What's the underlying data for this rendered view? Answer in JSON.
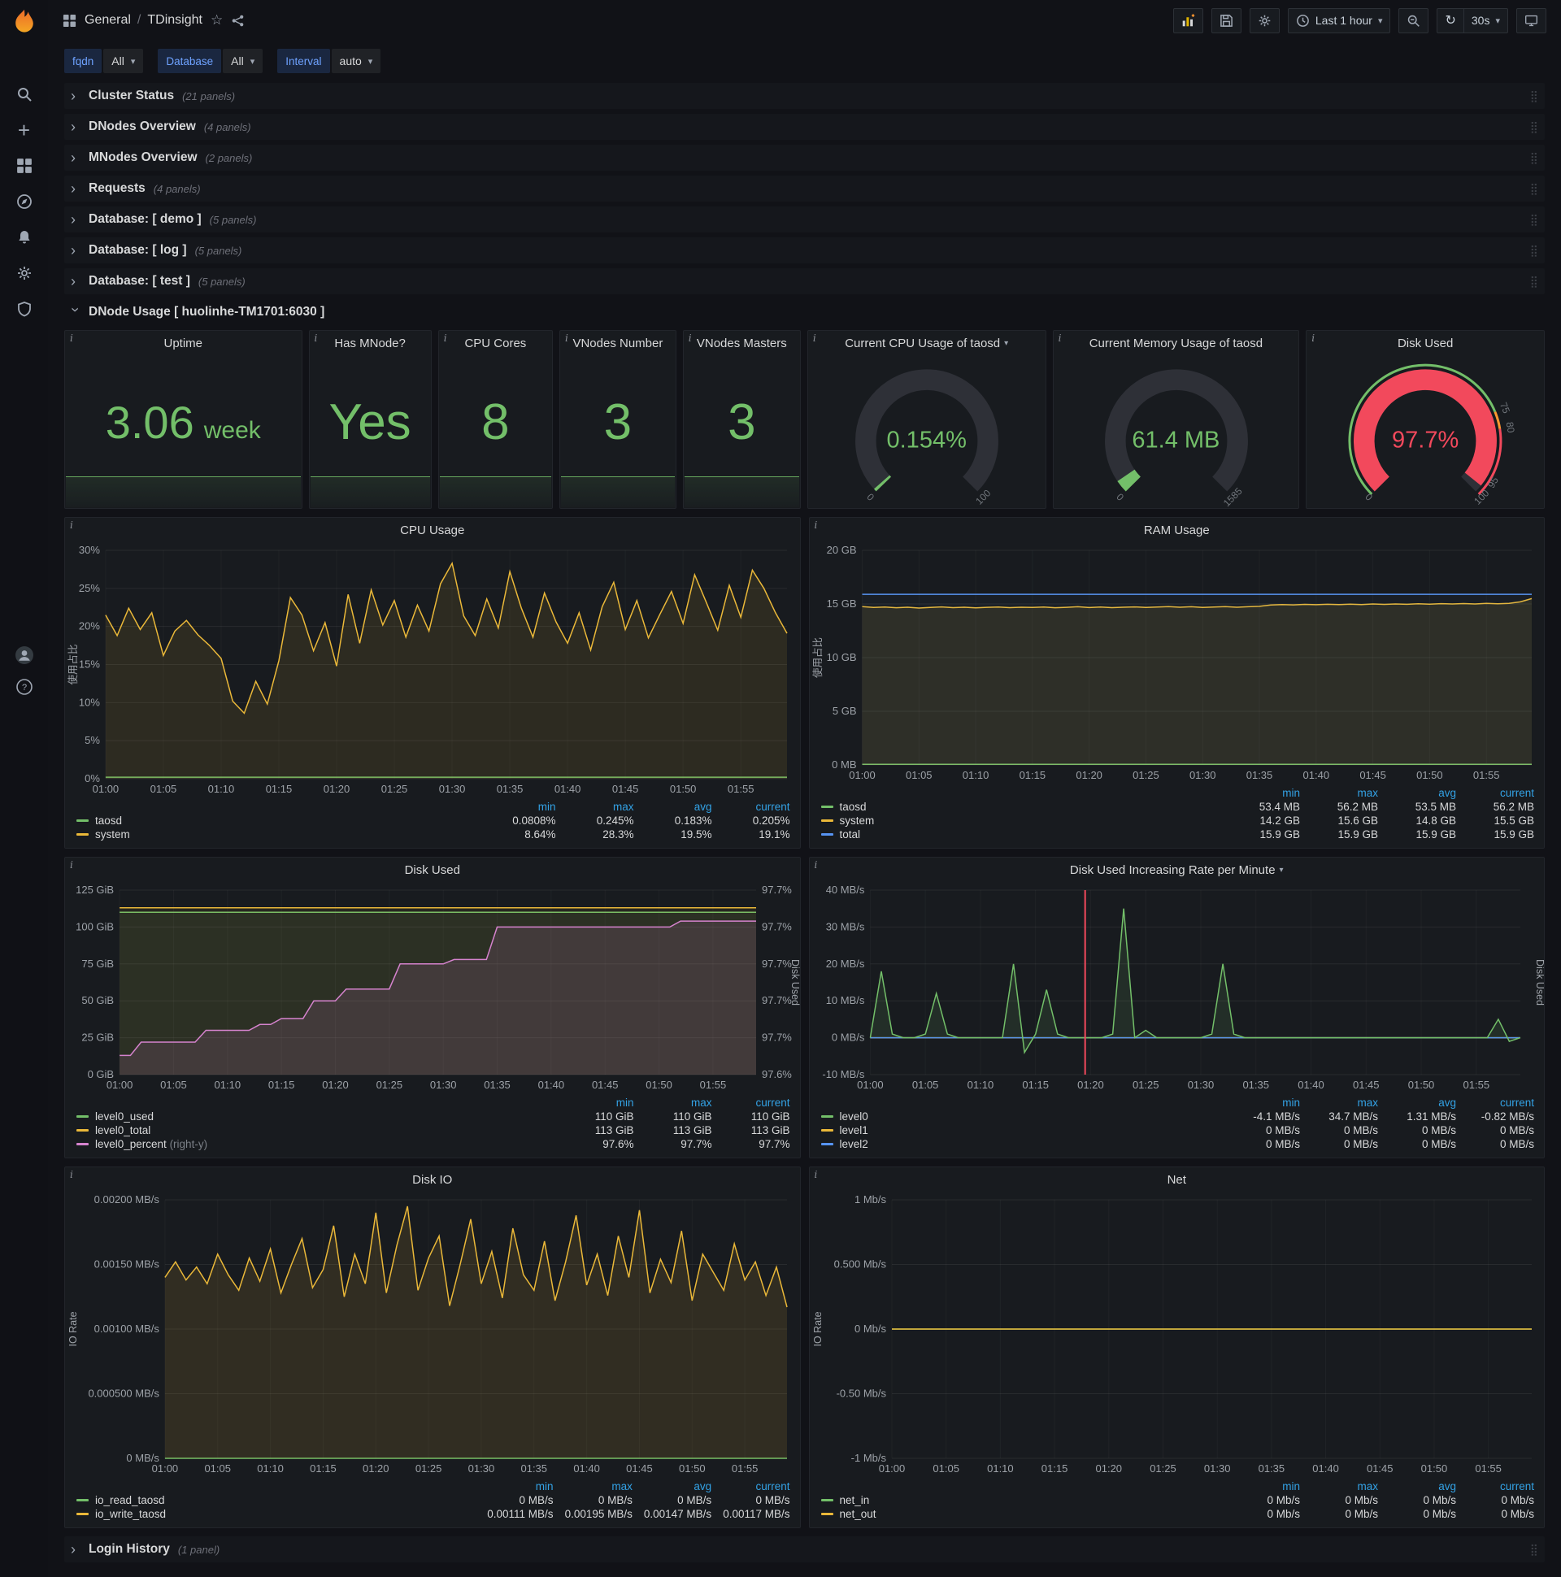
{
  "colors": {
    "green": "#73bf69",
    "yellow": "#eab839",
    "blue": "#5794f2",
    "pink": "#d683ce",
    "red": "#f2495c",
    "orange": "#ff9830",
    "legend_header": "#33a2e5",
    "stat_value": "#73bf69"
  },
  "navbar": {
    "breadcrumb_section": "General",
    "breadcrumb_sep": "/",
    "breadcrumb_title": "TDinsight",
    "time_range": "Last 1 hour",
    "refresh_interval": "30s"
  },
  "sidebar": {
    "icons": [
      "search",
      "create",
      "dashboards",
      "explore",
      "alerting",
      "configuration",
      "server-admin"
    ],
    "bottom": [
      "user-avatar",
      "help"
    ]
  },
  "variables": [
    {
      "label": "fqdn",
      "value": "All"
    },
    {
      "label": "Database",
      "value": "All"
    },
    {
      "label": "Interval",
      "value": "auto"
    }
  ],
  "rows": [
    {
      "title": "Cluster Status",
      "count": "(21 panels)"
    },
    {
      "title": "DNodes Overview",
      "count": "(4 panels)"
    },
    {
      "title": "MNodes Overview",
      "count": "(2 panels)"
    },
    {
      "title": "Requests",
      "count": "(4 panels)"
    },
    {
      "title": "Database: [ demo ]",
      "count": "(5 panels)"
    },
    {
      "title": "Database: [ log ]",
      "count": "(5 panels)"
    },
    {
      "title": "Database: [ test ]",
      "count": "(5 panels)"
    }
  ],
  "expanded_row": {
    "title": "DNode Usage [ huolinhe-TM1701:6030 ]"
  },
  "bottom_row": {
    "title": "Login History",
    "count": "(1 panel)"
  },
  "stats": [
    {
      "title": "Uptime",
      "value": "3.06",
      "unit": "week"
    },
    {
      "title": "Has MNode?",
      "value": "Yes"
    },
    {
      "title": "CPU Cores",
      "value": "8"
    },
    {
      "title": "VNodes Number",
      "value": "3"
    },
    {
      "title": "VNodes Masters",
      "value": "3"
    }
  ],
  "gauges": [
    {
      "title": "Current CPU Usage of taosd",
      "has_menu": true,
      "value": "0.154%",
      "value_color": "#73bf69",
      "arc_color": "#73bf69",
      "percent": 0.154,
      "min_label": "0",
      "max_label": "100"
    },
    {
      "title": "Current Memory Usage of taosd",
      "value": "61.4 MB",
      "value_color": "#73bf69",
      "arc_color": "#73bf69",
      "percent": 3.9,
      "min_label": "0",
      "max_label": "1585"
    },
    {
      "title": "Disk Used",
      "value": "97.7%",
      "value_color": "#f2495c",
      "arc_color": "#f2495c",
      "percent": 97.7,
      "min_label": "0",
      "max_label": "100",
      "threshold_segments": [
        {
          "to": 75,
          "color": "#73bf69"
        },
        {
          "to": 80,
          "color": "#ff9830"
        },
        {
          "to": 100,
          "color": "#f2495c"
        }
      ],
      "threshold_labels": [
        {
          "pct": 75,
          "label": "75"
        },
        {
          "pct": 80,
          "label": "80"
        },
        {
          "pct": 95,
          "label": "95"
        }
      ]
    }
  ],
  "charts": [
    {
      "type": "line",
      "title": "CPU Usage",
      "ylabel": "使用占比",
      "ylim": [
        0,
        30
      ],
      "yticks": [
        {
          "v": 30,
          "label": "30%"
        },
        {
          "v": 25,
          "label": "25%"
        },
        {
          "v": 20,
          "label": "20%"
        },
        {
          "v": 15,
          "label": "15%"
        },
        {
          "v": 10,
          "label": "10%"
        },
        {
          "v": 5,
          "label": "5%"
        },
        {
          "v": 0,
          "label": "0%"
        }
      ],
      "xticks": [
        "01:00",
        "01:05",
        "01:10",
        "01:15",
        "01:20",
        "01:25",
        "01:30",
        "01:35",
        "01:40",
        "01:45",
        "01:50",
        "01:55"
      ],
      "series": [
        {
          "name": "taosd",
          "color": "#73bf69",
          "fill": 0.06,
          "flat": 0.2
        },
        {
          "name": "system",
          "color": "#eab839",
          "fill": 0.1,
          "values": [
            21.5,
            18.8,
            22.4,
            19.6,
            21.8,
            16.2,
            19.4,
            20.8,
            18.9,
            17.5,
            15.8,
            10.2,
            8.6,
            12.8,
            9.8,
            15.5,
            23.8,
            21.5,
            16.8,
            20.5,
            14.8,
            24.2,
            17.8,
            24.8,
            20.2,
            23.4,
            18.6,
            22.8,
            19.4,
            25.6,
            28.3,
            21.4,
            18.8,
            23.6,
            19.8,
            27.2,
            22.4,
            18.6,
            24.4,
            20.6,
            17.8,
            21.8,
            16.9,
            22.6,
            25.8,
            19.6,
            23.4,
            18.5,
            21.6,
            24.6,
            20.4,
            26.8,
            23.2,
            19.5,
            25.4,
            21.2,
            27.4,
            25.0,
            21.8,
            19.1
          ]
        }
      ],
      "legend": {
        "columns": [
          "min",
          "max",
          "avg",
          "current"
        ],
        "rows": [
          {
            "name": "taosd",
            "color": "#73bf69",
            "values": [
              "0.0808%",
              "0.245%",
              "0.183%",
              "0.205%"
            ]
          },
          {
            "name": "system",
            "color": "#eab839",
            "values": [
              "8.64%",
              "28.3%",
              "19.5%",
              "19.1%"
            ]
          }
        ]
      }
    },
    {
      "type": "line",
      "title": "RAM Usage",
      "ylabel": "使用占比",
      "ylim": [
        0,
        20
      ],
      "yticks": [
        {
          "v": 20,
          "label": "20 GB"
        },
        {
          "v": 15,
          "label": "15 GB"
        },
        {
          "v": 10,
          "label": "10 GB"
        },
        {
          "v": 5,
          "label": "5 GB"
        },
        {
          "v": 0,
          "label": "0 MB"
        }
      ],
      "xticks": [
        "01:00",
        "01:05",
        "01:10",
        "01:15",
        "01:20",
        "01:25",
        "01:30",
        "01:35",
        "01:40",
        "01:45",
        "01:50",
        "01:55"
      ],
      "series": [
        {
          "name": "taosd",
          "color": "#73bf69",
          "fill": 0.05,
          "flat": 0.055
        },
        {
          "name": "system",
          "color": "#eab839",
          "fill": 0.1,
          "values": [
            14.75,
            14.68,
            14.72,
            14.65,
            14.7,
            14.62,
            14.68,
            14.73,
            14.66,
            14.7,
            14.64,
            14.69,
            14.72,
            14.66,
            14.7,
            14.68,
            14.72,
            14.65,
            14.69,
            14.74,
            14.67,
            14.71,
            14.66,
            14.7,
            14.73,
            14.68,
            14.72,
            14.75,
            14.7,
            14.74,
            14.68,
            14.72,
            14.76,
            14.7,
            14.74,
            14.78,
            14.9,
            14.95,
            14.92,
            14.96,
            14.93,
            14.97,
            14.94,
            14.98,
            14.95,
            15.0,
            14.96,
            15.0,
            14.97,
            15.02,
            14.98,
            15.03,
            15.0,
            15.04,
            15.0,
            15.05,
            15.02,
            15.06,
            15.2,
            15.5
          ]
        },
        {
          "name": "total",
          "color": "#5794f2",
          "fill": 0.04,
          "flat": 15.9
        }
      ],
      "legend": {
        "columns": [
          "min",
          "max",
          "avg",
          "current"
        ],
        "rows": [
          {
            "name": "taosd",
            "color": "#73bf69",
            "values": [
              "53.4 MB",
              "56.2 MB",
              "53.5 MB",
              "56.2 MB"
            ]
          },
          {
            "name": "system",
            "color": "#eab839",
            "values": [
              "14.2 GB",
              "15.6 GB",
              "14.8 GB",
              "15.5 GB"
            ]
          },
          {
            "name": "total",
            "color": "#5794f2",
            "values": [
              "15.9 GB",
              "15.9 GB",
              "15.9 GB",
              "15.9 GB"
            ]
          }
        ]
      }
    },
    {
      "type": "line",
      "title": "Disk Used",
      "ylim": [
        0,
        125
      ],
      "yticks": [
        {
          "v": 125,
          "label": "125 GiB"
        },
        {
          "v": 100,
          "label": "100 GiB"
        },
        {
          "v": 75,
          "label": "75 GiB"
        },
        {
          "v": 50,
          "label": "50 GiB"
        },
        {
          "v": 25,
          "label": "25 GiB"
        },
        {
          "v": 0,
          "label": "0 GiB"
        }
      ],
      "right_ticks": [
        "97.7%",
        "97.7%",
        "97.7%",
        "97.7%",
        "97.7%",
        "97.6%"
      ],
      "right_ylabel": "Disk Used",
      "xticks": [
        "01:00",
        "01:05",
        "01:10",
        "01:15",
        "01:20",
        "01:25",
        "01:30",
        "01:35",
        "01:40",
        "01:45",
        "01:50",
        "01:55"
      ],
      "series": [
        {
          "name": "level0_used",
          "color": "#73bf69",
          "fill": 0.07,
          "flat": 110
        },
        {
          "name": "level0_total",
          "color": "#eab839",
          "fill": 0.07,
          "flat": 113
        },
        {
          "name": "level0_percent",
          "color": "#d683ce",
          "fill": 0.13,
          "values": [
            13,
            13,
            22,
            22,
            22,
            22,
            22,
            22,
            30,
            30,
            30,
            30,
            30,
            34,
            34,
            38,
            38,
            38,
            50,
            50,
            50,
            58,
            58,
            58,
            58,
            58,
            75,
            75,
            75,
            75,
            75,
            78,
            78,
            78,
            78,
            100,
            100,
            100,
            100,
            100,
            100,
            100,
            100,
            100,
            100,
            100,
            100,
            100,
            100,
            100,
            100,
            100,
            104,
            104,
            104,
            104,
            104,
            104,
            104,
            104
          ]
        }
      ],
      "legend": {
        "columns": [
          "min",
          "max",
          "current"
        ],
        "rows": [
          {
            "name": "level0_used",
            "color": "#73bf69",
            "values": [
              "110 GiB",
              "110 GiB",
              "110 GiB"
            ]
          },
          {
            "name": "level0_total",
            "color": "#eab839",
            "values": [
              "113 GiB",
              "113 GiB",
              "113 GiB"
            ]
          },
          {
            "name": "level0_percent",
            "color": "#d683ce",
            "suffix": "(right-y)",
            "values": [
              "97.6%",
              "97.7%",
              "97.7%"
            ]
          }
        ]
      }
    },
    {
      "type": "line",
      "title": "Disk Used Increasing Rate per Minute",
      "has_menu": true,
      "ylim": [
        -10,
        40
      ],
      "yticks": [
        {
          "v": 40,
          "label": "40 MB/s"
        },
        {
          "v": 30,
          "label": "30 MB/s"
        },
        {
          "v": 20,
          "label": "20 MB/s"
        },
        {
          "v": 10,
          "label": "10 MB/s"
        },
        {
          "v": 0,
          "label": "0 MB/s"
        },
        {
          "v": -10,
          "label": "-10 MB/s"
        }
      ],
      "right_ylabel": "Disk Used",
      "annotation_x": 19.5,
      "xticks": [
        "01:00",
        "01:05",
        "01:10",
        "01:15",
        "01:20",
        "01:25",
        "01:30",
        "01:35",
        "01:40",
        "01:45",
        "01:50",
        "01:55"
      ],
      "series": [
        {
          "name": "level1",
          "color": "#eab839",
          "flat": 0
        },
        {
          "name": "level2",
          "color": "#5794f2",
          "flat": 0
        },
        {
          "name": "level0",
          "color": "#73bf69",
          "fill": 0.12,
          "values": [
            0,
            18,
            1,
            0,
            0,
            1,
            12,
            1,
            0,
            0,
            0,
            0,
            0,
            20,
            -4,
            1,
            13,
            1,
            0,
            0,
            0,
            0,
            1,
            35,
            0,
            2,
            0,
            0,
            0,
            0,
            0,
            1,
            20,
            1,
            0,
            0,
            0,
            0,
            0,
            0,
            0,
            0,
            0,
            0,
            0,
            0,
            0,
            0,
            0,
            0,
            0,
            0,
            0,
            0,
            0,
            0,
            0,
            5,
            -1,
            0
          ]
        }
      ],
      "legend": {
        "columns": [
          "min",
          "max",
          "avg",
          "current"
        ],
        "rows": [
          {
            "name": "level0",
            "color": "#73bf69",
            "values": [
              "-4.1 MB/s",
              "34.7 MB/s",
              "1.31 MB/s",
              "-0.82 MB/s"
            ]
          },
          {
            "name": "level1",
            "color": "#eab839",
            "values": [
              "0 MB/s",
              "0 MB/s",
              "0 MB/s",
              "0 MB/s"
            ]
          },
          {
            "name": "level2",
            "color": "#5794f2",
            "values": [
              "0 MB/s",
              "0 MB/s",
              "0 MB/s",
              "0 MB/s"
            ]
          }
        ]
      }
    },
    {
      "type": "line",
      "title": "Disk IO",
      "ylabel": "IO Rate",
      "ylim": [
        0,
        0.002
      ],
      "yticks": [
        {
          "v": 0.002,
          "label": "0.00200 MB/s"
        },
        {
          "v": 0.0015,
          "label": "0.00150 MB/s"
        },
        {
          "v": 0.001,
          "label": "0.00100 MB/s"
        },
        {
          "v": 0.0005,
          "label": "0.000500 MB/s"
        },
        {
          "v": 0,
          "label": "0 MB/s"
        }
      ],
      "xticks": [
        "01:00",
        "01:05",
        "01:10",
        "01:15",
        "01:20",
        "01:25",
        "01:30",
        "01:35",
        "01:40",
        "01:45",
        "01:50",
        "01:55"
      ],
      "series": [
        {
          "name": "io_read_taosd",
          "color": "#73bf69",
          "fill": 0.05,
          "flat": 0
        },
        {
          "name": "io_write_taosd",
          "color": "#eab839",
          "fill": 0.12,
          "values": [
            0.0014,
            0.00152,
            0.00138,
            0.00148,
            0.00135,
            0.00158,
            0.00142,
            0.0013,
            0.00155,
            0.00137,
            0.00162,
            0.00128,
            0.0015,
            0.0017,
            0.00132,
            0.00146,
            0.0018,
            0.00125,
            0.00158,
            0.00135,
            0.0019,
            0.00128,
            0.00165,
            0.00195,
            0.0013,
            0.00155,
            0.00172,
            0.00118,
            0.0015,
            0.00185,
            0.00135,
            0.0016,
            0.00124,
            0.00178,
            0.00142,
            0.0013,
            0.00168,
            0.00122,
            0.00152,
            0.00188,
            0.00134,
            0.00158,
            0.00126,
            0.00172,
            0.0014,
            0.00192,
            0.00128,
            0.00154,
            0.00136,
            0.00176,
            0.00122,
            0.00158,
            0.00144,
            0.0013,
            0.00166,
            0.00138,
            0.00152,
            0.00126,
            0.00148,
            0.00117
          ]
        }
      ],
      "legend": {
        "columns": [
          "min",
          "max",
          "avg",
          "current"
        ],
        "rows": [
          {
            "name": "io_read_taosd",
            "color": "#73bf69",
            "values": [
              "0 MB/s",
              "0 MB/s",
              "0 MB/s",
              "0 MB/s"
            ]
          },
          {
            "name": "io_write_taosd",
            "color": "#eab839",
            "values": [
              "0.00111 MB/s",
              "0.00195 MB/s",
              "0.00147 MB/s",
              "0.00117 MB/s"
            ]
          }
        ]
      }
    },
    {
      "type": "line",
      "title": "Net",
      "ylabel": "IO Rate",
      "ylim": [
        -1,
        1
      ],
      "yticks": [
        {
          "v": 1,
          "label": "1 Mb/s"
        },
        {
          "v": 0.5,
          "label": "0.500 Mb/s"
        },
        {
          "v": 0,
          "label": "0 Mb/s"
        },
        {
          "v": -0.5,
          "label": "-0.50 Mb/s"
        },
        {
          "v": -1,
          "label": "-1 Mb/s"
        }
      ],
      "xticks": [
        "01:00",
        "01:05",
        "01:10",
        "01:15",
        "01:20",
        "01:25",
        "01:30",
        "01:35",
        "01:40",
        "01:45",
        "01:50",
        "01:55"
      ],
      "series": [
        {
          "name": "net_in",
          "color": "#73bf69",
          "flat": 0
        },
        {
          "name": "net_out",
          "color": "#eab839",
          "flat": 0
        }
      ],
      "legend": {
        "columns": [
          "min",
          "max",
          "avg",
          "current"
        ],
        "rows": [
          {
            "name": "net_in",
            "color": "#73bf69",
            "values": [
              "0 Mb/s",
              "0 Mb/s",
              "0 Mb/s",
              "0 Mb/s"
            ]
          },
          {
            "name": "net_out",
            "color": "#eab839",
            "values": [
              "0 Mb/s",
              "0 Mb/s",
              "0 Mb/s",
              "0 Mb/s"
            ]
          }
        ]
      }
    }
  ]
}
